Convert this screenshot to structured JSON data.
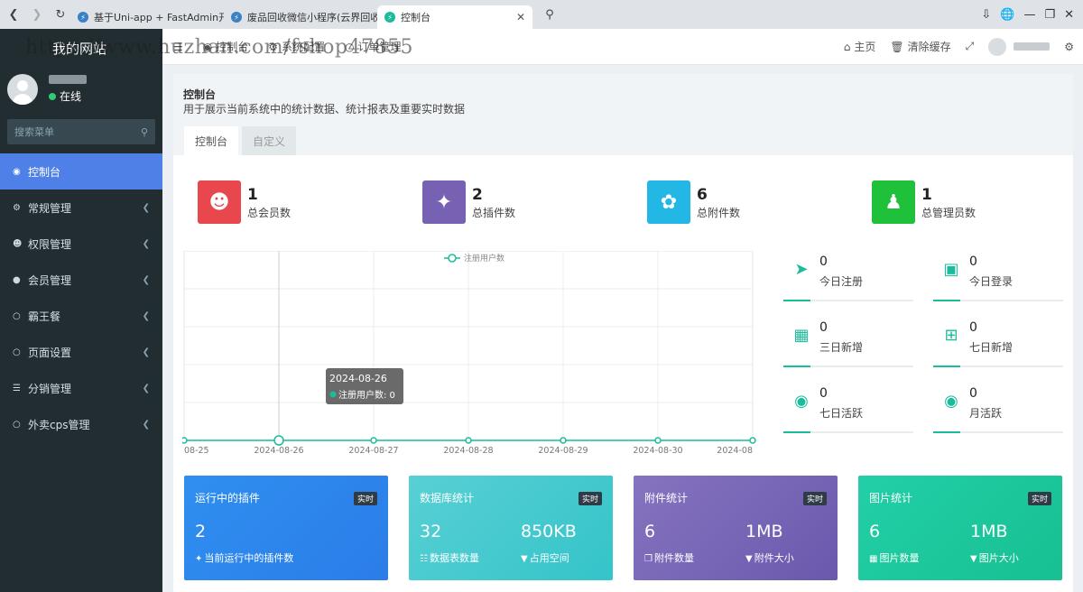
{
  "browser": {
    "tabs": [
      {
        "label": "基于Uni-app + FastAdmin开发的"
      },
      {
        "label": "废品回收微信小程序(云界回收系统"
      },
      {
        "label": "控制台"
      }
    ]
  },
  "watermark": "https://www.huzhan.com/fshop47855",
  "sidebar": {
    "logo": "我的网站",
    "user_status": "在线",
    "search_placeholder": "搜索菜单",
    "items": [
      {
        "label": "控制台"
      },
      {
        "label": "常规管理"
      },
      {
        "label": "权限管理"
      },
      {
        "label": "会员管理"
      },
      {
        "label": "霸王餐"
      },
      {
        "label": "页面设置"
      },
      {
        "label": "分销管理"
      },
      {
        "label": "外卖cps管理"
      }
    ]
  },
  "topbar": {
    "tabs": [
      {
        "label": "控制台"
      },
      {
        "label": "系统配置"
      },
      {
        "label": "订单管理"
      }
    ],
    "home": "主页",
    "clear_cache": "清除缓存"
  },
  "page": {
    "title": "控制台",
    "desc": "用于展示当前系统中的统计数据、统计报表及重要实时数据",
    "tabs": [
      {
        "label": "控制台"
      },
      {
        "label": "自定义"
      }
    ]
  },
  "stats": [
    {
      "value": "1",
      "label": "总会员数",
      "color": "#e9474e"
    },
    {
      "value": "2",
      "label": "总插件数",
      "color": "#7661b3"
    },
    {
      "value": "6",
      "label": "总附件数",
      "color": "#22b7e4"
    },
    {
      "value": "1",
      "label": "总管理员数",
      "color": "#1fc13a"
    }
  ],
  "mini_stats": [
    {
      "value": "0",
      "label": "今日注册"
    },
    {
      "value": "0",
      "label": "今日登录"
    },
    {
      "value": "0",
      "label": "三日新增"
    },
    {
      "value": "0",
      "label": "七日新增"
    },
    {
      "value": "0",
      "label": "七日活跃"
    },
    {
      "value": "0",
      "label": "月活跃"
    }
  ],
  "chart_data": {
    "type": "line",
    "x": [
      "08-25",
      "2024-08-26",
      "2024-08-27",
      "2024-08-28",
      "2024-08-29",
      "2024-08-30",
      "2024-08"
    ],
    "series": [
      {
        "name": "注册用户数",
        "values": [
          0,
          0,
          0,
          0,
          0,
          0,
          0
        ]
      }
    ],
    "tooltip": {
      "date": "2024-08-26",
      "text": "注册用户数: 0"
    },
    "legend": "top-center",
    "grid": true,
    "color": "#1abc9c"
  },
  "cards": [
    {
      "title": "运行中的插件",
      "badge": "实时",
      "v1": "2",
      "s1": "当前运行中的插件数"
    },
    {
      "title": "数据库统计",
      "badge": "实时",
      "v1": "32",
      "s1": "数据表数量",
      "v2": "850KB",
      "s2": "占用空间"
    },
    {
      "title": "附件统计",
      "badge": "实时",
      "v1": "6",
      "s1": "附件数量",
      "v2": "1MB",
      "s2": "附件大小"
    },
    {
      "title": "图片统计",
      "badge": "实时",
      "v1": "6",
      "s1": "图片数量",
      "v2": "1MB",
      "s2": "图片大小"
    }
  ]
}
